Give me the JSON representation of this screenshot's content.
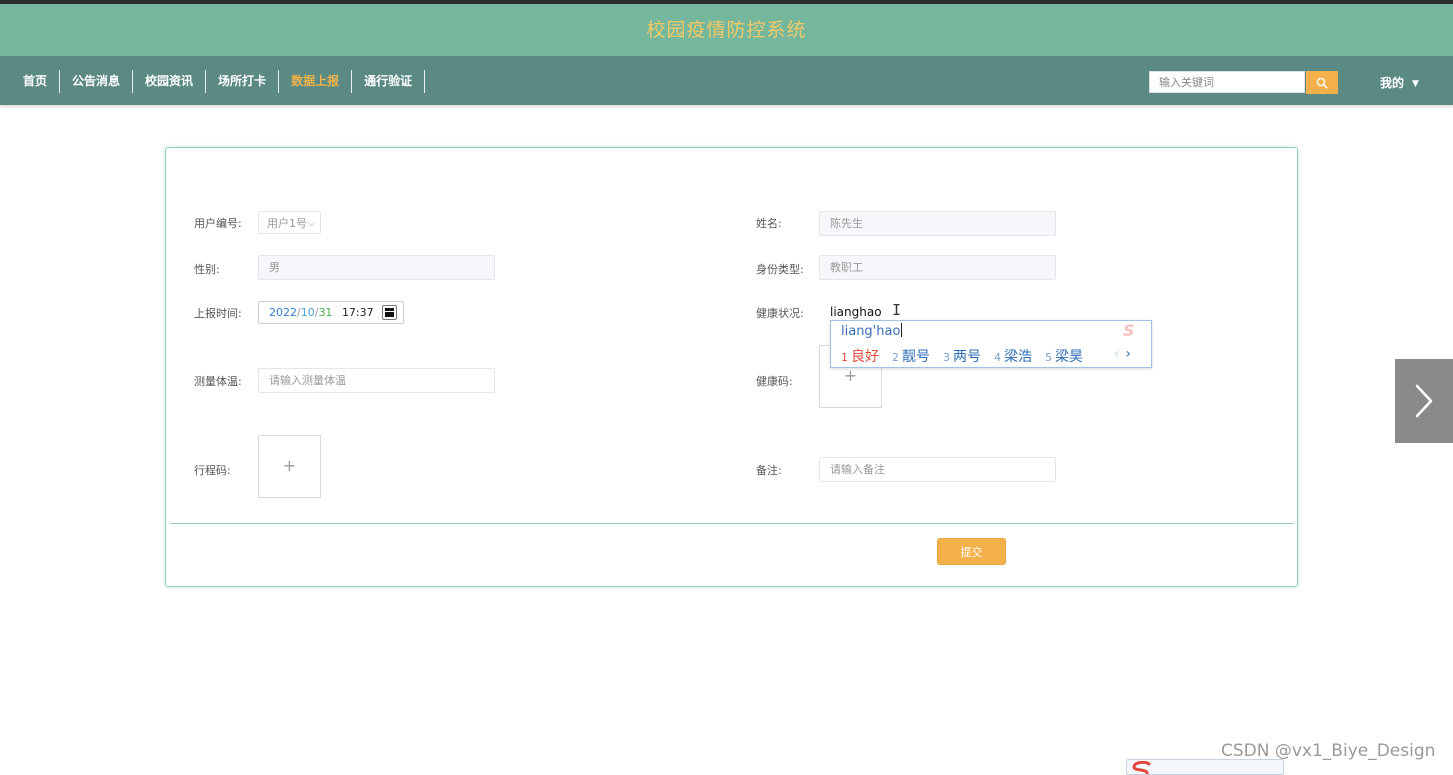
{
  "header": {
    "title": "校园疫情防控系统"
  },
  "nav": {
    "items": [
      {
        "label": "首页"
      },
      {
        "label": "公告消息"
      },
      {
        "label": "校园资讯"
      },
      {
        "label": "场所打卡"
      },
      {
        "label": "数据上报",
        "active": true
      },
      {
        "label": "通行验证"
      }
    ],
    "search_placeholder": "输入关键词",
    "user_menu": "我的"
  },
  "form": {
    "user_id": {
      "label": "用户编号:",
      "value": "用户1号"
    },
    "name": {
      "label": "姓名:",
      "value": "陈先生"
    },
    "gender": {
      "label": "性别:",
      "value": "男"
    },
    "identity_type": {
      "label": "身份类型:",
      "value": "教职工"
    },
    "report_time": {
      "label": "上报时间:",
      "year": "2022",
      "month": "10",
      "day": "31",
      "time": "17:37"
    },
    "health_status": {
      "label": "健康状况:",
      "value": "lianghao"
    },
    "temperature": {
      "label": "测量体温:",
      "placeholder": "请输入测量体温"
    },
    "health_code": {
      "label": "健康码:",
      "upload_symbol": "+"
    },
    "travel_code": {
      "label": "行程码:",
      "upload_symbol": "+"
    },
    "remark": {
      "label": "备注:",
      "placeholder": "请输入备注"
    },
    "submit_label": "提交"
  },
  "ime": {
    "pinyin": "liang'hao",
    "candidates": [
      {
        "num": "1",
        "text": "良好"
      },
      {
        "num": "2",
        "text": "靓号"
      },
      {
        "num": "3",
        "text": "两号"
      },
      {
        "num": "4",
        "text": "梁浩"
      },
      {
        "num": "5",
        "text": "梁昊"
      }
    ]
  },
  "watermark": "CSDN @vx1_Biye_Design",
  "colors": {
    "banner": "#74b79c",
    "nav": "#5b8a84",
    "accent": "#f4b04a",
    "title": "#f3c968"
  }
}
